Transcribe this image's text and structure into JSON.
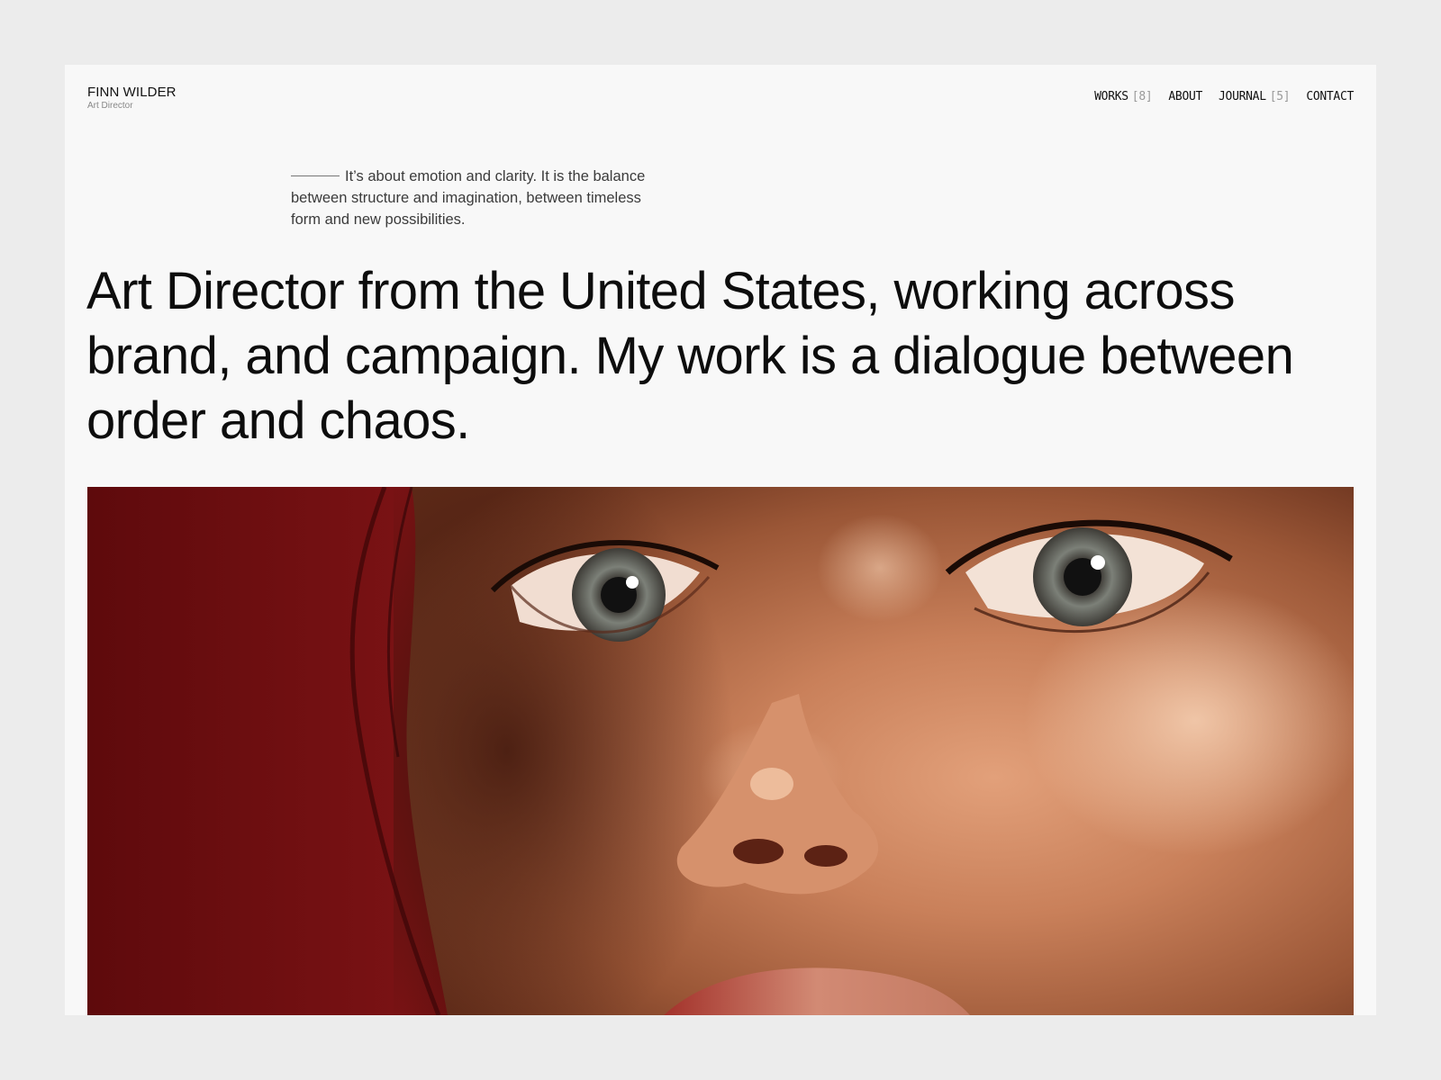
{
  "brand": {
    "name": "FINN WILDER",
    "role": "Art Director"
  },
  "nav": {
    "items": [
      {
        "label": "WORKS",
        "count": "[8]"
      },
      {
        "label": "ABOUT"
      },
      {
        "label": "JOURNAL",
        "count": "[5]"
      },
      {
        "label": "CONTACT"
      }
    ]
  },
  "intro": {
    "text": "It’s about emotion and clarity. It is the balance between structure and imagination, between timeless form and new possibilities."
  },
  "headline": {
    "text": "Art Director from the United States, working across brand, and campaign. My work is a dialogue between order and chaos."
  },
  "hero": {
    "image": "close-up portrait of a woman's face with freckles on a red background"
  },
  "colors": {
    "page_background": "#ececec",
    "card_background": "#f8f8f8",
    "text_primary": "#0d0d0d",
    "text_muted": "#888888",
    "hero_red": "#6a0d0f"
  }
}
